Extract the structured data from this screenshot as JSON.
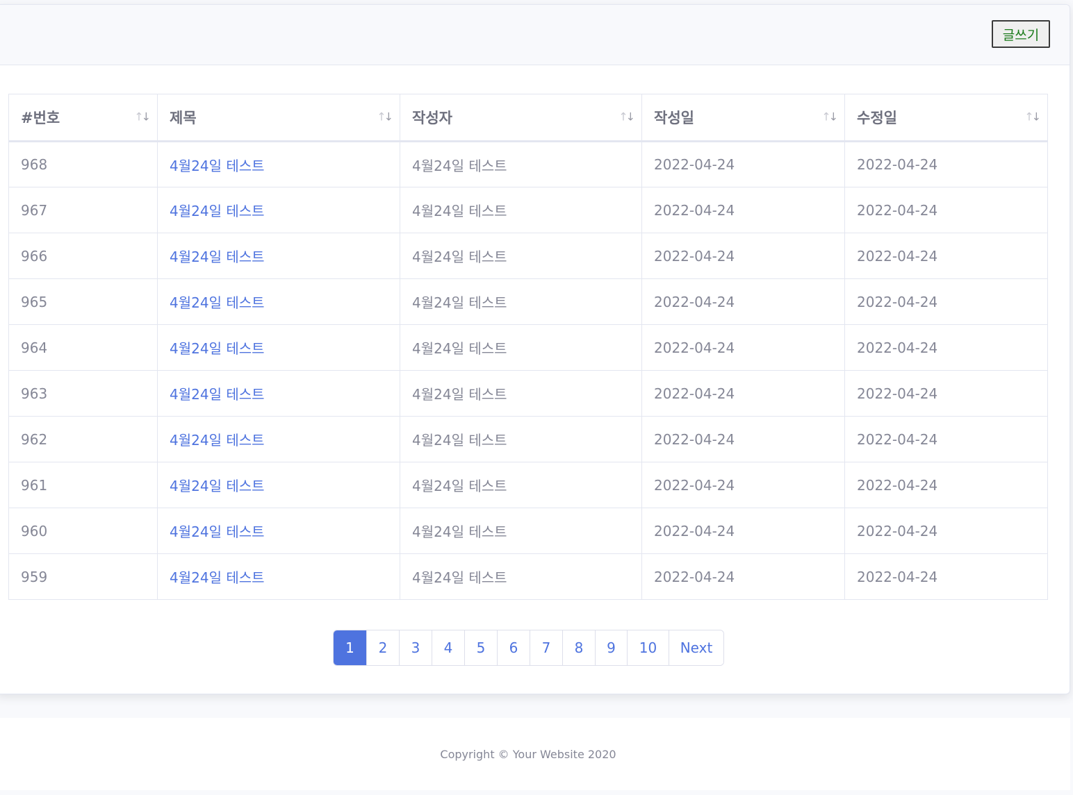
{
  "header": {
    "write_button": "글쓰기"
  },
  "table": {
    "columns": [
      "#번호",
      "제목",
      "작성자",
      "작성일",
      "수정일"
    ],
    "rows": [
      {
        "no": "968",
        "title": "4월24일 테스트",
        "author": "4월24일 테스트",
        "created": "2022-04-24",
        "modified": "2022-04-24"
      },
      {
        "no": "967",
        "title": "4월24일 테스트",
        "author": "4월24일 테스트",
        "created": "2022-04-24",
        "modified": "2022-04-24"
      },
      {
        "no": "966",
        "title": "4월24일 테스트",
        "author": "4월24일 테스트",
        "created": "2022-04-24",
        "modified": "2022-04-24"
      },
      {
        "no": "965",
        "title": "4월24일 테스트",
        "author": "4월24일 테스트",
        "created": "2022-04-24",
        "modified": "2022-04-24"
      },
      {
        "no": "964",
        "title": "4월24일 테스트",
        "author": "4월24일 테스트",
        "created": "2022-04-24",
        "modified": "2022-04-24"
      },
      {
        "no": "963",
        "title": "4월24일 테스트",
        "author": "4월24일 테스트",
        "created": "2022-04-24",
        "modified": "2022-04-24"
      },
      {
        "no": "962",
        "title": "4월24일 테스트",
        "author": "4월24일 테스트",
        "created": "2022-04-24",
        "modified": "2022-04-24"
      },
      {
        "no": "961",
        "title": "4월24일 테스트",
        "author": "4월24일 테스트",
        "created": "2022-04-24",
        "modified": "2022-04-24"
      },
      {
        "no": "960",
        "title": "4월24일 테스트",
        "author": "4월24일 테스트",
        "created": "2022-04-24",
        "modified": "2022-04-24"
      },
      {
        "no": "959",
        "title": "4월24일 테스트",
        "author": "4월24일 테스트",
        "created": "2022-04-24",
        "modified": "2022-04-24"
      }
    ]
  },
  "pagination": {
    "pages": [
      "1",
      "2",
      "3",
      "4",
      "5",
      "6",
      "7",
      "8",
      "9",
      "10"
    ],
    "active": "1",
    "next_label": "Next"
  },
  "footer": {
    "copyright": "Copyright © Your Website 2020"
  },
  "colors": {
    "accent": "#4e73df",
    "text": "#858796",
    "border": "#e3e6f0",
    "button_text": "#1a7a1a"
  }
}
